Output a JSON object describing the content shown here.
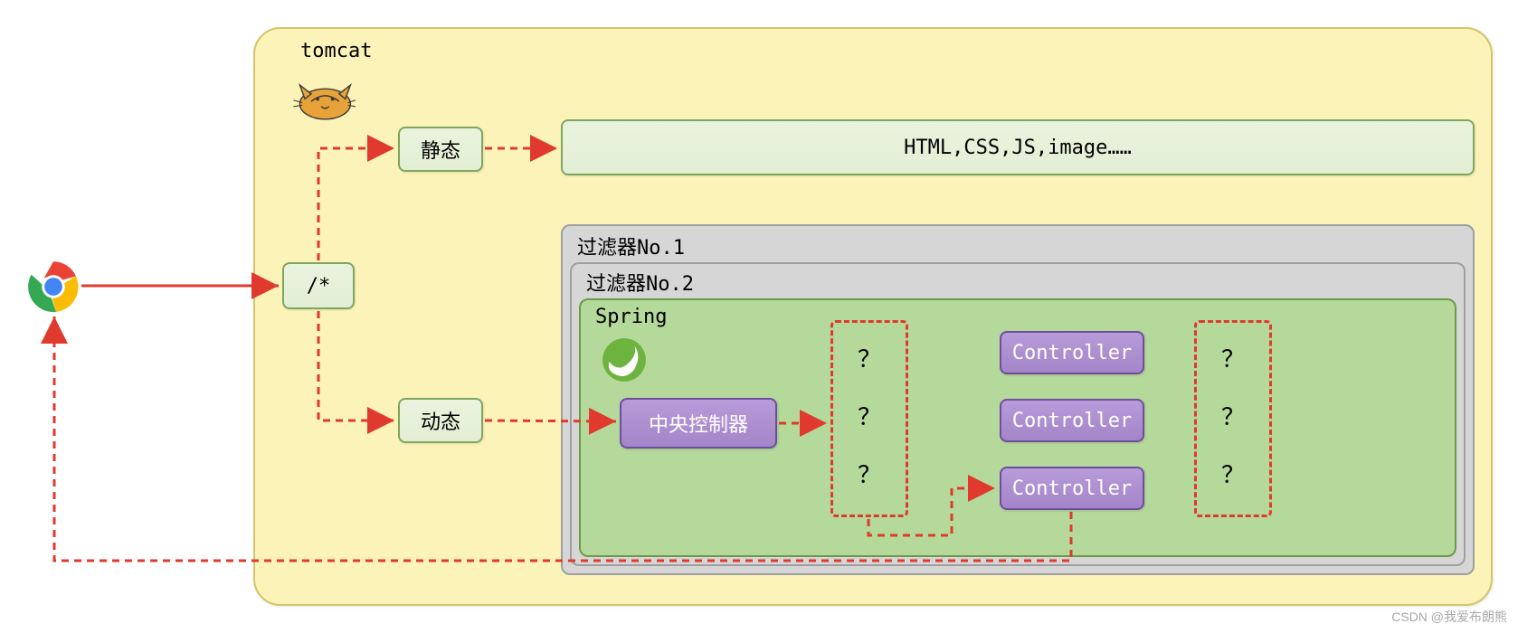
{
  "labels": {
    "tomcat": "tomcat",
    "static": "静态",
    "slashstar": "/*",
    "dynamic": "动态",
    "htmlcss": "HTML,CSS,JS,image……",
    "filter1": "过滤器No.1",
    "filter2": "过滤器No.2",
    "spring": "Spring",
    "central": "中央控制器",
    "controller": "Controller",
    "q": "？",
    "watermark": "CSDN @我爱布朗熊"
  },
  "colors": {
    "arrow": "#e03a2f",
    "tomcat_bg": "#fcf3b8",
    "green_box": "#e6f1da",
    "purple_box": "#a98dd0",
    "spring_bg": "#b5d99a"
  }
}
